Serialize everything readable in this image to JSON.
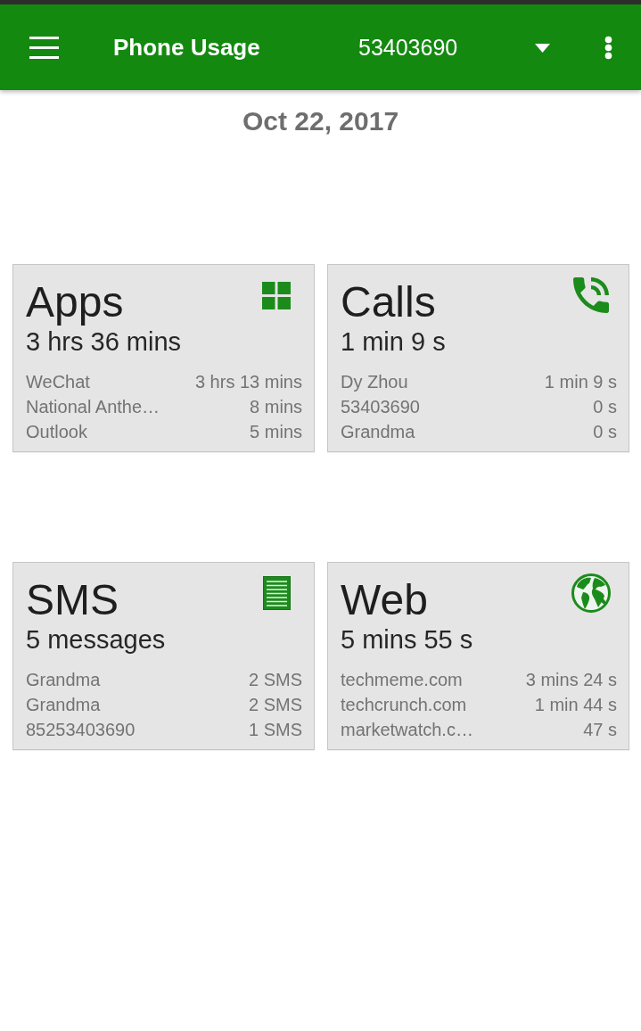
{
  "app_bar": {
    "title": "Phone Usage",
    "account": "53403690"
  },
  "date": "Oct 22, 2017",
  "cards": [
    {
      "kind": "apps",
      "title": "Apps",
      "total": "3 hrs 36 mins",
      "rows": [
        {
          "name": "WeChat",
          "value": "3 hrs 13 mins"
        },
        {
          "name": "National Anthe…",
          "value": "8 mins"
        },
        {
          "name": "Outlook",
          "value": "5 mins"
        }
      ]
    },
    {
      "kind": "calls",
      "title": "Calls",
      "total": "1 min 9 s",
      "rows": [
        {
          "name": "Dy Zhou",
          "value": "1 min 9 s"
        },
        {
          "name": "53403690",
          "value": "0 s"
        },
        {
          "name": "Grandma",
          "value": "0 s"
        }
      ]
    },
    {
      "kind": "sms",
      "title": "SMS",
      "total": "5 messages",
      "rows": [
        {
          "name": "Grandma",
          "value": "2 SMS"
        },
        {
          "name": "Grandma",
          "value": "2 SMS"
        },
        {
          "name": "85253403690",
          "value": "1 SMS"
        }
      ]
    },
    {
      "kind": "web",
      "title": "Web",
      "total": "5 mins 55 s",
      "rows": [
        {
          "name": "techmeme.com",
          "value": "3 mins 24 s"
        },
        {
          "name": "techcrunch.com",
          "value": "1 min 44 s"
        },
        {
          "name": "marketwatch.c…",
          "value": "47 s"
        }
      ]
    }
  ]
}
